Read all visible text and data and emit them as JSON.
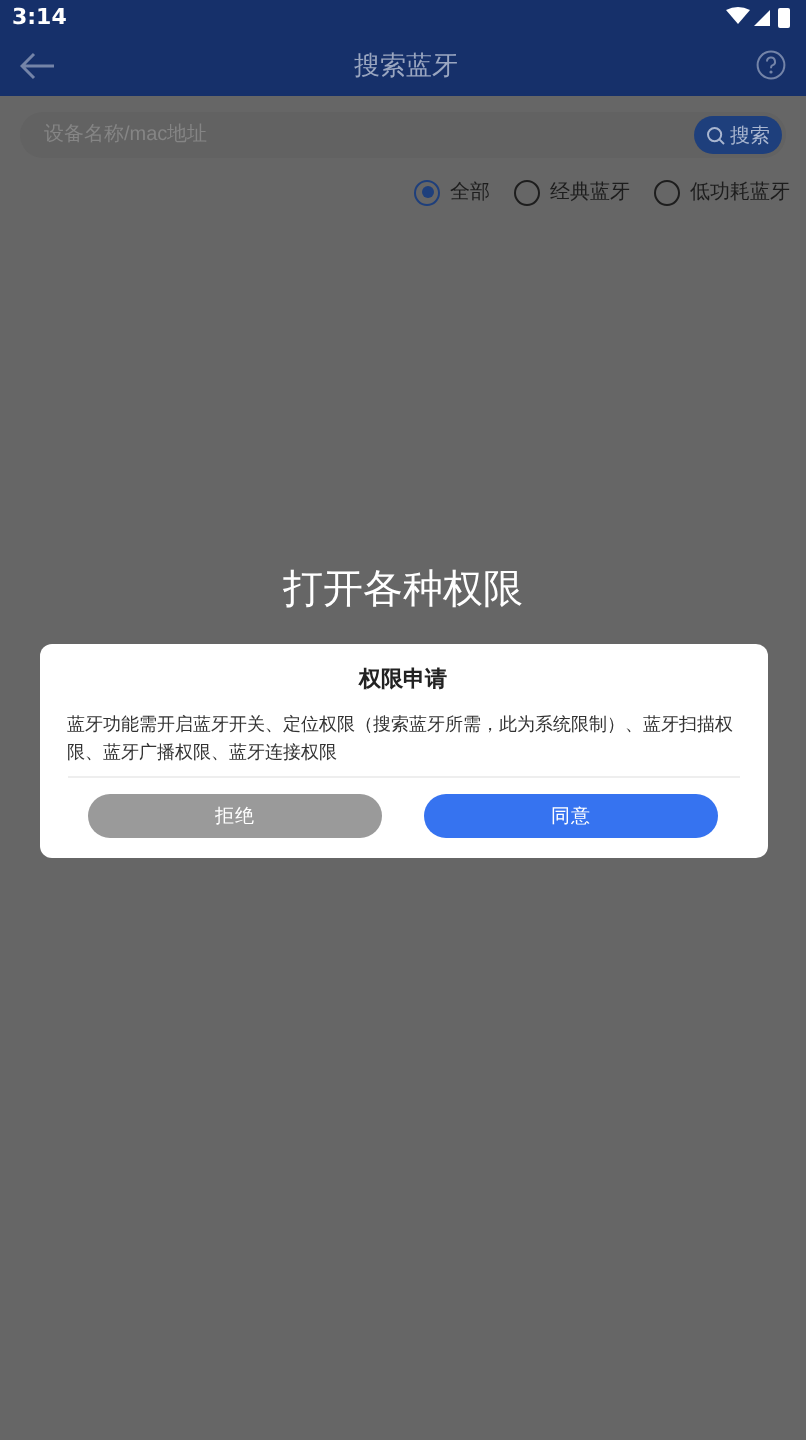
{
  "status_bar": {
    "time": "3:14"
  },
  "app_bar": {
    "title": "搜索蓝牙"
  },
  "search": {
    "placeholder": "设备名称/mac地址",
    "button": "搜索"
  },
  "filters": [
    {
      "label": "全部",
      "selected": true
    },
    {
      "label": "经典蓝牙",
      "selected": false
    },
    {
      "label": "低功耗蓝牙",
      "selected": false
    }
  ],
  "overlay_title": "打开各种权限",
  "dialog": {
    "title": "权限申请",
    "message": "蓝牙功能需开启蓝牙开关、定位权限（搜索蓝牙所需，此为系统限制）、蓝牙扫描权限、蓝牙广播权限、蓝牙连接权限",
    "buttons": [
      {
        "label": "拒绝",
        "kind": "secondary"
      },
      {
        "label": "同意",
        "kind": "primary"
      }
    ]
  }
}
